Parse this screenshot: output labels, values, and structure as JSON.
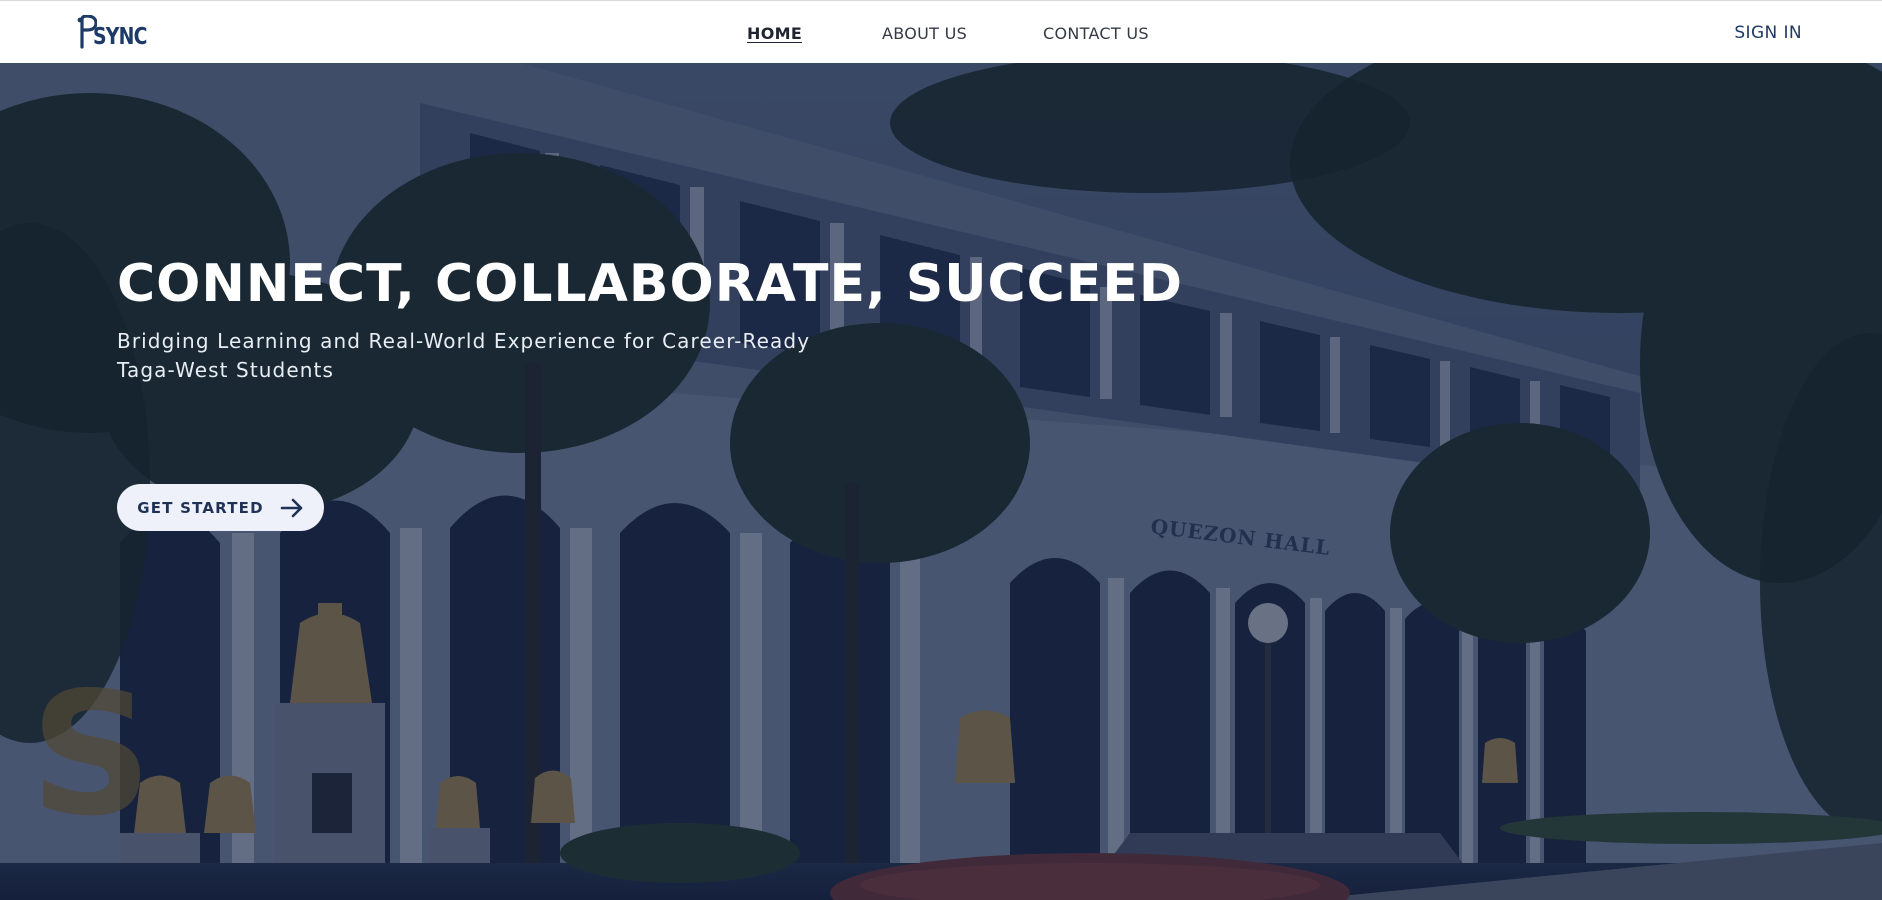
{
  "brand": {
    "logo_text": "SYNC",
    "color": "#1e3a66"
  },
  "nav": {
    "items": [
      {
        "label": "HOME",
        "active": true
      },
      {
        "label": "ABOUT US",
        "active": false
      },
      {
        "label": "CONTACT US",
        "active": false
      }
    ],
    "sign_in_label": "SIGN IN"
  },
  "hero": {
    "title": "CONNECT, COLLABORATE, SUCCEED",
    "subtitle": "Bridging Learning and Real-World Experience for Career-Ready Taga-West Students",
    "cta_label": "GET STARTED",
    "cta_icon": "arrow-right-icon",
    "building_sign": "QUEZON HALL",
    "overlay_color": "#101c38"
  },
  "colors": {
    "accent": "#1e3a66",
    "button_bg": "#eef1f9",
    "hero_text": "#ffffff"
  }
}
